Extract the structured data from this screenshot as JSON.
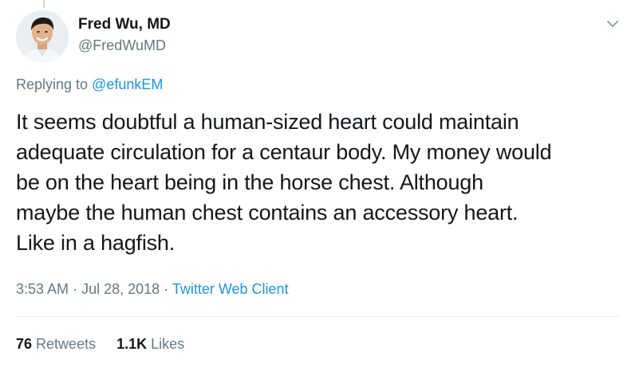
{
  "author": {
    "name": "Fred Wu, MD",
    "handle": "@FredWuMD"
  },
  "reply": {
    "prefix": "Replying to",
    "mention": "@efunkEM"
  },
  "tweet": {
    "lines": [
      "It seems doubtful a human-sized heart could maintain",
      "adequate circulation for a centaur body. My money would",
      "be on the heart being in the horse chest. Although",
      "maybe the human chest contains an accessory heart.",
      "Like in a hagfish."
    ]
  },
  "meta": {
    "time": "3:53 AM",
    "separator1": "·",
    "date": "Jul 28, 2018",
    "separator2": "·",
    "client": "Twitter Web Client"
  },
  "stats": {
    "retweets_count": "76",
    "retweets_label": "Retweets",
    "likes_count": "1.1K",
    "likes_label": "Likes"
  },
  "icons": {
    "menu": "chevron-down-icon",
    "avatar": "profile-photo"
  },
  "colors": {
    "text": "#14171a",
    "secondary": "#657786",
    "link": "#1b95e0",
    "divider": "#e6ecf0"
  }
}
